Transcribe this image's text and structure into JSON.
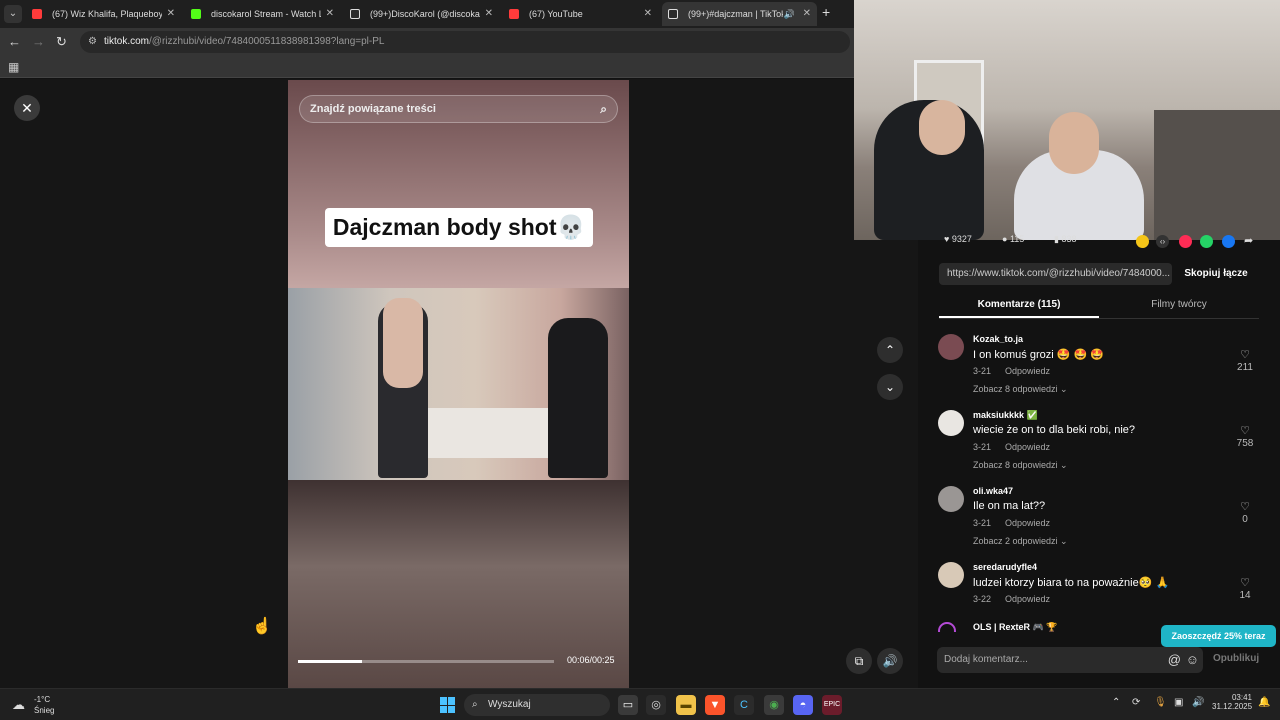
{
  "browser": {
    "tabs": [
      {
        "label": "(67) Wiz Khalifa, Plaqueboy Ma",
        "color": "#ff3b3b"
      },
      {
        "label": "discokarol Stream - Watch Live",
        "color": "#53fc18"
      },
      {
        "label": "(99+)DiscoKarol (@discokarol_",
        "color": "#ffffff"
      },
      {
        "label": "(67) YouTube",
        "color": "#ff3b3b"
      },
      {
        "label": "(99+)#dajczman | TikTok",
        "color": "#ffffff"
      }
    ],
    "url_domain": "tiktok.com",
    "url_path": "/@rizzhubi/video/7484000511838981398?lang=pl-PL"
  },
  "video": {
    "search_placeholder": "Znajdź powiązane treści",
    "caption": "Dajczman body shot💀",
    "progress": 0.25,
    "time": "00:06/00:25"
  },
  "panel": {
    "stats": {
      "likes": "9327",
      "comments": "115",
      "saves": "838"
    },
    "link": "https://www.tiktok.com/@rizzhubi/video/7484000...",
    "copy_label": "Skopiuj łącze",
    "tab_comments": "Komentarze (115)",
    "tab_creator": "Filmy twórcy",
    "comments": [
      {
        "user": "Kozak_to.ja",
        "text": "I on komuś grozi 🤩 🤩 🤩",
        "date": "3-21",
        "reply": "Odpowiedz",
        "more": "Zobacz 8 odpowiedzi ⌄",
        "likes": "211",
        "avatar": "#7a4b52"
      },
      {
        "user": "maksiukkkk ✅",
        "text": "wiecie że on to dla beki robi, nie?",
        "date": "3-21",
        "reply": "Odpowiedz",
        "more": "Zobacz 8 odpowiedzi ⌄",
        "likes": "758",
        "avatar": "#e9e6e2"
      },
      {
        "user": "oli.wka47",
        "text": "Ile on ma lat??",
        "date": "3-21",
        "reply": "Odpowiedz",
        "more": "Zobacz 2 odpowiedzi ⌄",
        "likes": "0",
        "avatar": "#9a9694"
      },
      {
        "user": "seredarudyfle4",
        "text": "ludzei ktorzy biara to na poważnie🥺 🙏",
        "date": "3-22",
        "reply": "Odpowiedz",
        "more": "",
        "likes": "14",
        "avatar": "#d8c9b7"
      }
    ],
    "partial_user": "OLS | RexteR 🎮 🏆",
    "promo": "Zaoszczędź 25% teraz",
    "add_comment_placeholder": "Dodaj komentarz...",
    "post_label": "Opublikuj"
  },
  "taskbar": {
    "temp": "-1°C",
    "weather_desc": "Śnieg",
    "search_label": "Wyszukaj",
    "time": "03:41",
    "date": "31.12.2025"
  }
}
